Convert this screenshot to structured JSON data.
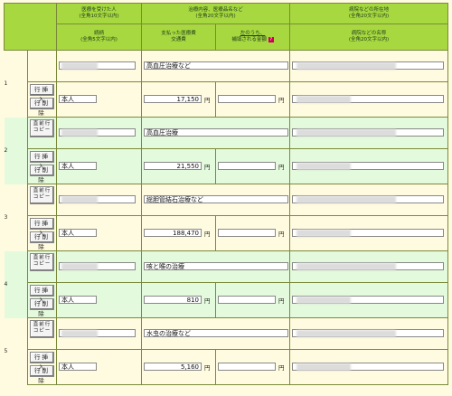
{
  "header": {
    "col1_top": "医療を受けた人",
    "col1_top_note": "(全角10文字以内)",
    "col2_top": "治療内容、医療品名など",
    "col2_top_note": "(全角20文字以内)",
    "col3_top": "病院などの所在地",
    "col3_top_note": "(全角20文字以内)",
    "col1_bottom": "続柄",
    "col1_bottom_note": "(全角5文字以内)",
    "col2a_bottom": "支払った医療費",
    "col2a_bottom_note": "交通費",
    "col2b_bottom": "左のうち、",
    "col2b_bottom_note": "補填される金額",
    "col3_bottom": "病院などの名称",
    "col3_bottom_note": "(全角20文字以内)"
  },
  "buttons": {
    "insert": "行挿入",
    "delete": "行削除",
    "copy": "直前行コピー"
  },
  "yen": "円",
  "rows": [
    {
      "index": "1",
      "relation": "本人",
      "treatment": "高血圧治療など",
      "amount": "17,150",
      "has_copy": false
    },
    {
      "index": "2",
      "relation": "本人",
      "treatment": "高血圧治療",
      "amount": "21,550",
      "has_copy": true
    },
    {
      "index": "3",
      "relation": "本人",
      "treatment": "総胆管結石治療など",
      "amount": "188,470",
      "has_copy": true
    },
    {
      "index": "4",
      "relation": "本人",
      "treatment": "咳と喉の治療",
      "amount": "810",
      "has_copy": true
    },
    {
      "index": "5",
      "relation": "本人",
      "treatment": "水虫の治療など",
      "amount": "5,160",
      "has_copy": true
    }
  ]
}
